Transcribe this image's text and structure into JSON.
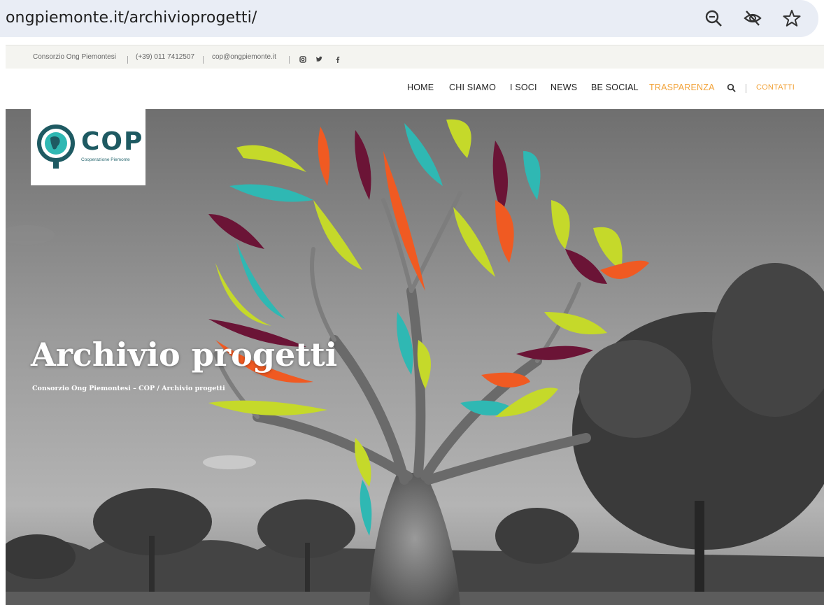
{
  "browser": {
    "url": "ongpiemonte.it/archivioprogetti/",
    "icons": [
      "zoom-out-icon",
      "eye-off-icon",
      "star-bookmark-icon"
    ]
  },
  "topbar": {
    "org": "Consorzio Ong Piemontesi",
    "phone": "(+39) 011 7412507",
    "email": "cop@ongpiemonte.it",
    "social": [
      "instagram-icon",
      "twitter-icon",
      "facebook-icon"
    ]
  },
  "nav": {
    "items": [
      "HOME",
      "CHI SIAMO",
      "I SOCI",
      "NEWS",
      "BE SOCIAL",
      "TRASPARENZA"
    ],
    "contact": "CONTATTI",
    "accent": "#f2a33a"
  },
  "logo": {
    "name": "COP",
    "tagline": "Cooperazione Piemonte",
    "color": "#1e5a62"
  },
  "hero": {
    "title": "Archivio progetti",
    "breadcrumb": "Consorzio Ong Piemontesi – COP / Archivio progetti"
  }
}
